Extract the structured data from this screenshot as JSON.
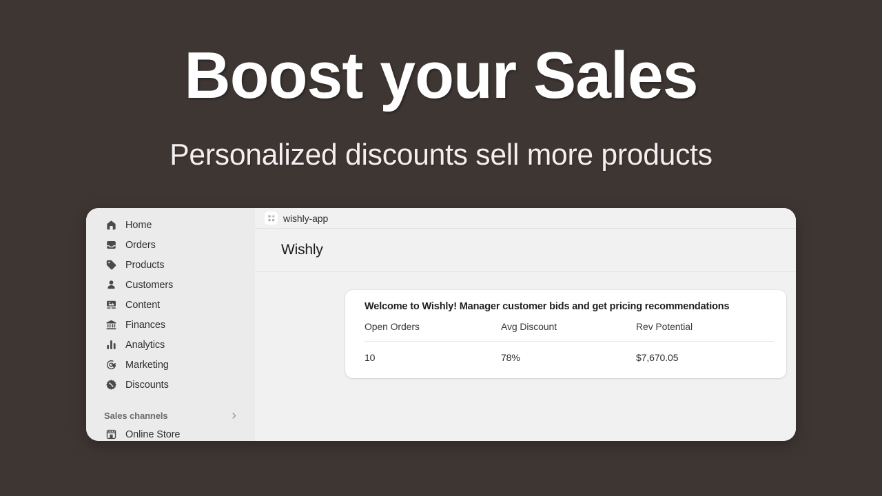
{
  "hero": {
    "title": "Boost your Sales",
    "subtitle": "Personalized discounts sell more products"
  },
  "colors": {
    "background": "#3E3633",
    "sidebar": "#EBEBEB",
    "main": "#F1F1F1",
    "card": "#FFFFFF",
    "text": "#303030",
    "hero_text": "#FFFFFF"
  },
  "sidebar": {
    "items": [
      {
        "label": "Home",
        "icon": "home-icon"
      },
      {
        "label": "Orders",
        "icon": "orders-inbox-icon"
      },
      {
        "label": "Products",
        "icon": "product-tag-icon"
      },
      {
        "label": "Customers",
        "icon": "person-icon"
      },
      {
        "label": "Content",
        "icon": "content-image-icon"
      },
      {
        "label": "Finances",
        "icon": "bank-icon"
      },
      {
        "label": "Analytics",
        "icon": "bar-chart-icon"
      },
      {
        "label": "Marketing",
        "icon": "target-cursor-icon"
      },
      {
        "label": "Discounts",
        "icon": "discount-percent-badge-icon"
      }
    ],
    "section": {
      "label": "Sales channels",
      "chevron": "chevron-right-icon"
    },
    "channels": [
      {
        "label": "Online Store",
        "icon": "storefront-icon"
      }
    ]
  },
  "topbar": {
    "app_icon": "apps-grid-plus-icon",
    "app_name": "wishly-app"
  },
  "page": {
    "title": "Wishly"
  },
  "card": {
    "title": "Welcome to Wishly! Manager customer bids and get pricing recommendations",
    "table": {
      "headers": [
        "Open Orders",
        "Avg Discount",
        "Rev Potential"
      ],
      "rows": [
        [
          "10",
          "78%",
          "$7,670.05"
        ]
      ]
    }
  }
}
